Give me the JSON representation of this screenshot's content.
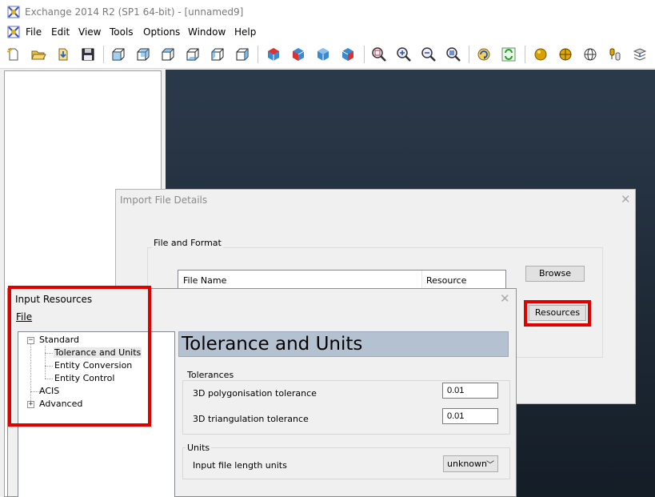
{
  "window": {
    "title": "Exchange 2014 R2 (SP1 64-bit) - [unnamed9]"
  },
  "menubar": {
    "items": [
      "File",
      "Edit",
      "View",
      "Tools",
      "Options",
      "Window",
      "Help"
    ]
  },
  "toolbar": {
    "icons": [
      "new-icon",
      "open-icon",
      "import-icon",
      "save-icon",
      "view-front-icon",
      "view-back-icon",
      "view-top-icon",
      "view-bottom-icon",
      "view-left-icon",
      "view-right-icon",
      "iso-view-1-icon",
      "iso-view-2-icon",
      "iso-view-3-icon",
      "iso-view-4-icon",
      "zoom-window-icon",
      "zoom-in-icon",
      "zoom-out-icon",
      "zoom-fit-icon",
      "rotate-icon",
      "refresh-icon",
      "shaded-sphere-icon",
      "sphere-edges-icon",
      "wireframe-sphere-icon",
      "probe-icon",
      "layers-icon"
    ]
  },
  "import_dialog": {
    "title": "Import File Details",
    "group_label": "File and Format",
    "columns": [
      "File Name",
      "Resource"
    ],
    "browse_label": "Browse",
    "resources_label": "Resources"
  },
  "resources_dialog": {
    "title": "Input Resources",
    "file_menu": "File",
    "tree": {
      "standard": "Standard",
      "children": [
        "Tolerance and Units",
        "Entity Conversion",
        "Entity Control"
      ],
      "acis": "ACIS",
      "advanced": "Advanced"
    },
    "page_title": "Tolerance and Units",
    "tolerances": {
      "label": "Tolerances",
      "polygonisation_label": "3D polygonisation tolerance",
      "polygonisation_value": "0.01",
      "triangulation_label": "3D triangulation tolerance",
      "triangulation_value": "0.01"
    },
    "units": {
      "label": "Units",
      "length_label": "Input file length units",
      "length_value": "unknown"
    }
  },
  "colors": {
    "highlight": "#e00000",
    "viewport": "#1f2a37",
    "header_bar": "#b3c1d0"
  }
}
